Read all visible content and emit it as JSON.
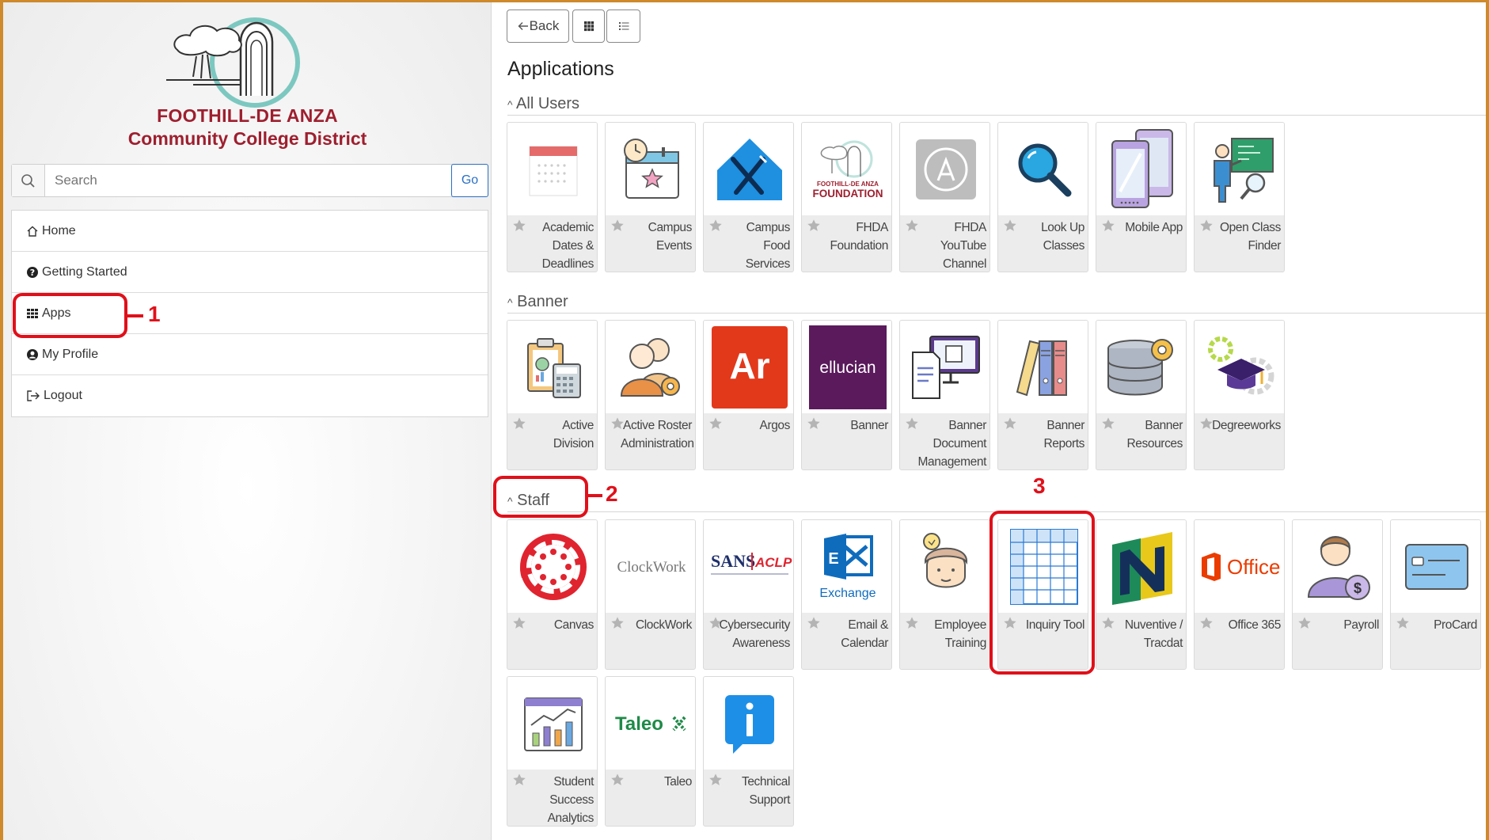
{
  "org": {
    "line1": "FOOTHILL-DE ANZA",
    "line2": "Community College District"
  },
  "search": {
    "placeholder": "Search",
    "button": "Go"
  },
  "nav": [
    {
      "label": "Home",
      "icon": "home-icon"
    },
    {
      "label": "Getting Started",
      "icon": "question-circle-icon"
    },
    {
      "label": "Apps",
      "icon": "grid-icon"
    },
    {
      "label": "My Profile",
      "icon": "user-circle-icon"
    },
    {
      "label": "Logout",
      "icon": "logout-icon"
    }
  ],
  "toolbar": {
    "back": "Back",
    "grid_icon": "grid-view-icon",
    "list_icon": "list-view-icon"
  },
  "page_title": "Applications",
  "sections": [
    {
      "title": "All Users",
      "apps": [
        {
          "label": "Academic Dates & Deadlines",
          "icon": "calendar-icon"
        },
        {
          "label": "Campus Events",
          "icon": "event-calendar-icon"
        },
        {
          "label": "Campus Food Services",
          "icon": "utensils-icon"
        },
        {
          "label": "FHDA Foundation",
          "icon": "foundation-logo"
        },
        {
          "label": "FHDA YouTube Channel",
          "icon": "app-store-icon"
        },
        {
          "label": "Look Up Classes",
          "icon": "magnifier-icon"
        },
        {
          "label": "Mobile App",
          "icon": "mobile-devices-icon"
        },
        {
          "label": "Open Class Finder",
          "icon": "teacher-board-icon"
        }
      ]
    },
    {
      "title": "Banner",
      "apps": [
        {
          "label": "Active Division",
          "icon": "clipboard-calculator-icon"
        },
        {
          "label": "Active Roster Administration",
          "icon": "users-gear-icon"
        },
        {
          "label": "Argos",
          "icon": "argos-logo"
        },
        {
          "label": "Banner",
          "icon": "ellucian-logo"
        },
        {
          "label": "Banner Document Management",
          "icon": "document-monitor-icon"
        },
        {
          "label": "Banner Reports",
          "icon": "binders-icon"
        },
        {
          "label": "Banner Resources",
          "icon": "database-gear-icon"
        },
        {
          "label": "Degreeworks",
          "icon": "graduation-cap-icon"
        }
      ]
    },
    {
      "title": "Staff",
      "apps": [
        {
          "label": "Canvas",
          "icon": "canvas-logo"
        },
        {
          "label": "ClockWork",
          "icon": "clockwork-logo"
        },
        {
          "label": "Cybersecurity Awareness",
          "icon": "sans-aclp-logo"
        },
        {
          "label": "Email & Calendar",
          "icon": "exchange-logo"
        },
        {
          "label": "Employee Training",
          "icon": "person-idea-icon"
        },
        {
          "label": "Inquiry Tool",
          "icon": "table-grid-icon"
        },
        {
          "label": "Nuventive / Tracdat",
          "icon": "nuventive-logo"
        },
        {
          "label": "Office 365",
          "icon": "office-logo"
        },
        {
          "label": "Payroll",
          "icon": "person-dollar-icon"
        },
        {
          "label": "ProCard",
          "icon": "credit-card-icon"
        },
        {
          "label": "Student Success Analytics",
          "icon": "analytics-chart-icon"
        },
        {
          "label": "Taleo",
          "icon": "taleo-logo"
        },
        {
          "label": "Technical Support",
          "icon": "info-icon"
        }
      ]
    }
  ],
  "logo_text": {
    "argos": "Ar",
    "ellucian": "ellucian",
    "clockwork": "ClockWork",
    "sans": "SANS",
    "aclp": "ACLP",
    "exchange": "Exchange",
    "office": "Office",
    "taleo": "Taleo",
    "foundation_small": "FOOTHILL-DE ANZA",
    "foundation": "FOUNDATION"
  },
  "annotations": {
    "one": "1",
    "two": "2",
    "three": "3"
  },
  "colors": {
    "annotation": "#e0101a",
    "brand": "#9e1f2f",
    "link": "#2a6fc4",
    "frame": "#cf8a2b"
  }
}
